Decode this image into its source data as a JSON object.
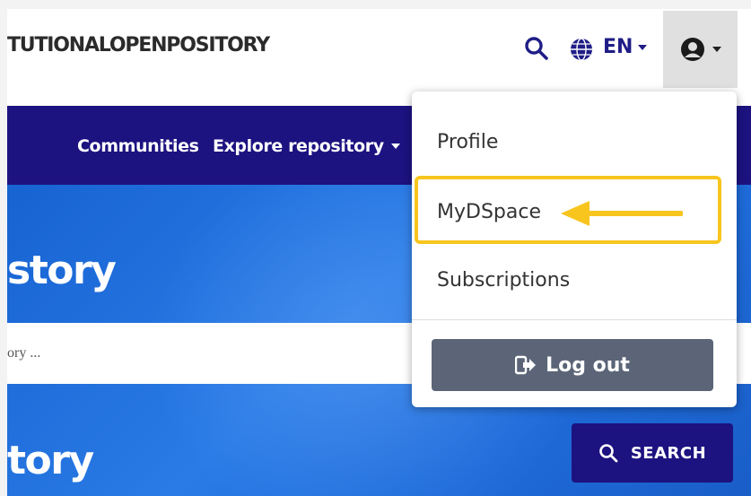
{
  "header": {
    "logo_text": "TUTIONALOPENPOSITORY",
    "search_icon": "search-icon",
    "language": "EN",
    "globe_icon": "globe-icon",
    "user_icon": "user-circle-icon"
  },
  "navbar": {
    "items": [
      {
        "label": "Communities"
      },
      {
        "label": "Explore repository"
      }
    ]
  },
  "hero": {
    "title_top": "story",
    "search_placeholder": "ory ...",
    "title_bottom": "tory",
    "search_button": "SEARCH"
  },
  "user_menu": {
    "items": [
      {
        "label": "Profile"
      },
      {
        "label": "MyDSpace"
      },
      {
        "label": "Subscriptions"
      }
    ],
    "logout_label": "Log out",
    "logout_icon": "sign-out-icon"
  },
  "colors": {
    "navy": "#1c1280",
    "accent_blue": "#1f1d86",
    "highlight": "#f7c51e",
    "logout_bg": "#5b6577"
  }
}
